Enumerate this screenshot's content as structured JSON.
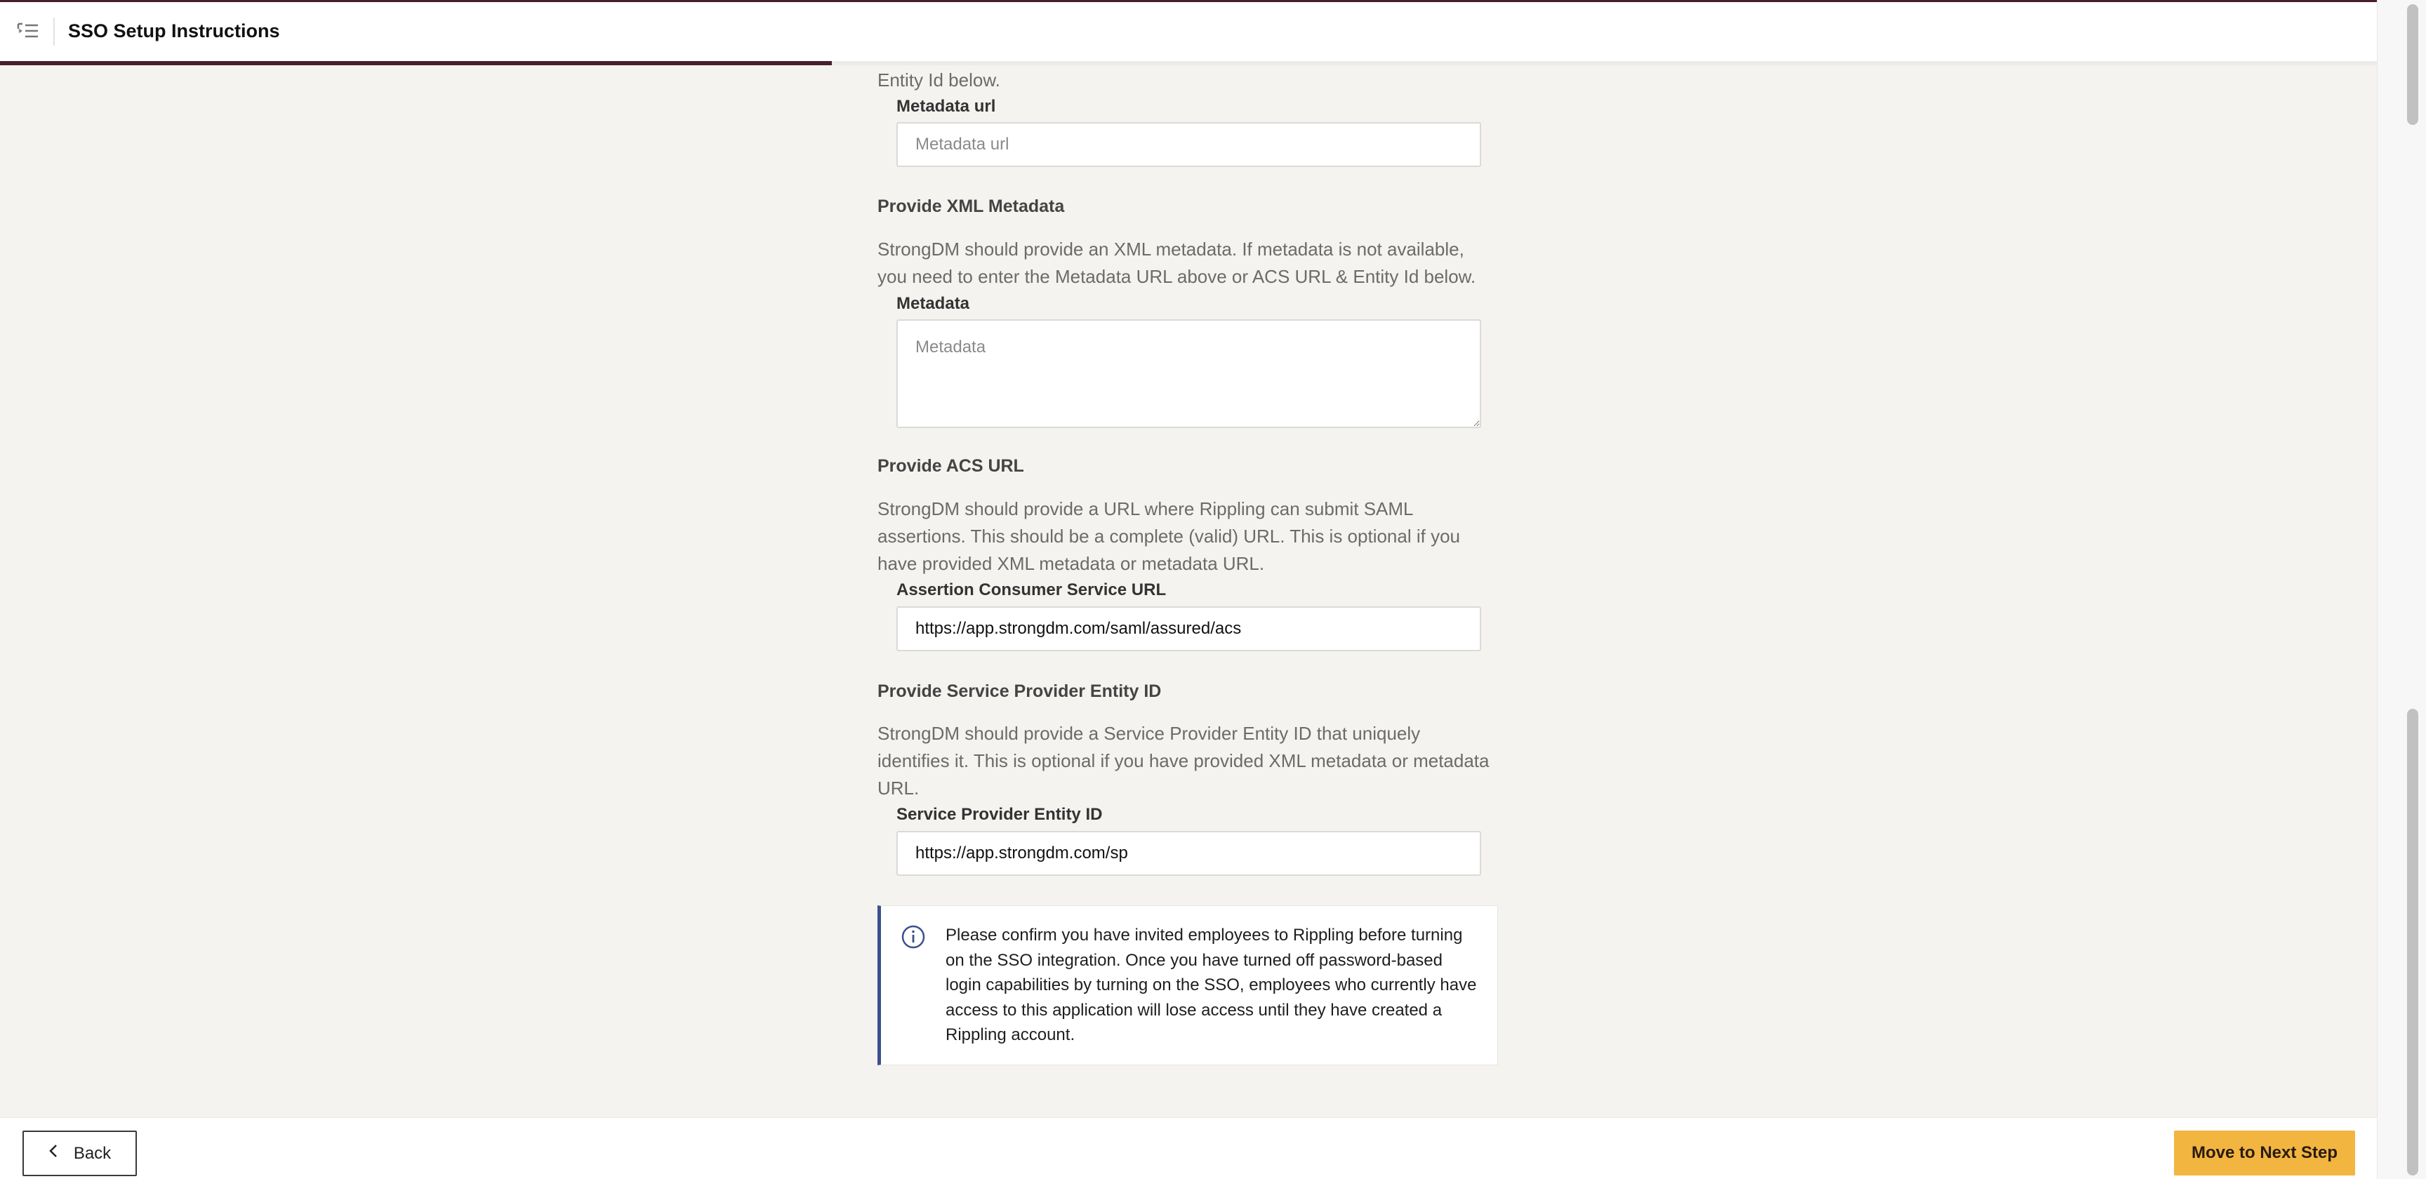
{
  "header": {
    "title": "SSO Setup Instructions",
    "progress_fraction": 0.35
  },
  "content": {
    "intro_tail": "Entity Id below.",
    "metadata_url": {
      "label": "Metadata url",
      "placeholder": "Metadata url",
      "value": ""
    },
    "xml_section": {
      "title": "Provide XML Metadata",
      "description": "StrongDM should provide an XML metadata. If metadata is not available, you need to enter the Metadata URL above or ACS URL & Entity Id below.",
      "label": "Metadata",
      "placeholder": "Metadata",
      "value": ""
    },
    "acs_section": {
      "title": "Provide ACS URL",
      "description": "StrongDM should provide a URL where Rippling can submit SAML assertions. This should be a complete (valid) URL. This is optional if you have provided XML metadata or metadata URL.",
      "label": "Assertion Consumer Service URL",
      "value": "https://app.strongdm.com/saml/assured/acs"
    },
    "entity_section": {
      "title": "Provide Service Provider Entity ID",
      "description": "StrongDM should provide a Service Provider Entity ID that uniquely identifies it. This is optional if you have provided XML metadata or metadata URL.",
      "label": "Service Provider Entity ID",
      "value": "https://app.strongdm.com/sp"
    },
    "info_notice": "Please confirm you have invited employees to Rippling before turning on the SSO integration. Once you have turned off password-based login capabilities by turning on the SSO, employees who currently have access to this application will lose access until they have created a Rippling account."
  },
  "footer": {
    "back_label": "Back",
    "next_label": "Move to Next Step"
  },
  "colors": {
    "brand": "#4a1f2a",
    "primary_button": "#f2b540",
    "info_accent": "#3c4f8f",
    "background": "#f4f3f0"
  },
  "icons": {
    "menu": "list-menu-icon",
    "info": "info-circle-icon",
    "back": "chevron-left-icon"
  }
}
